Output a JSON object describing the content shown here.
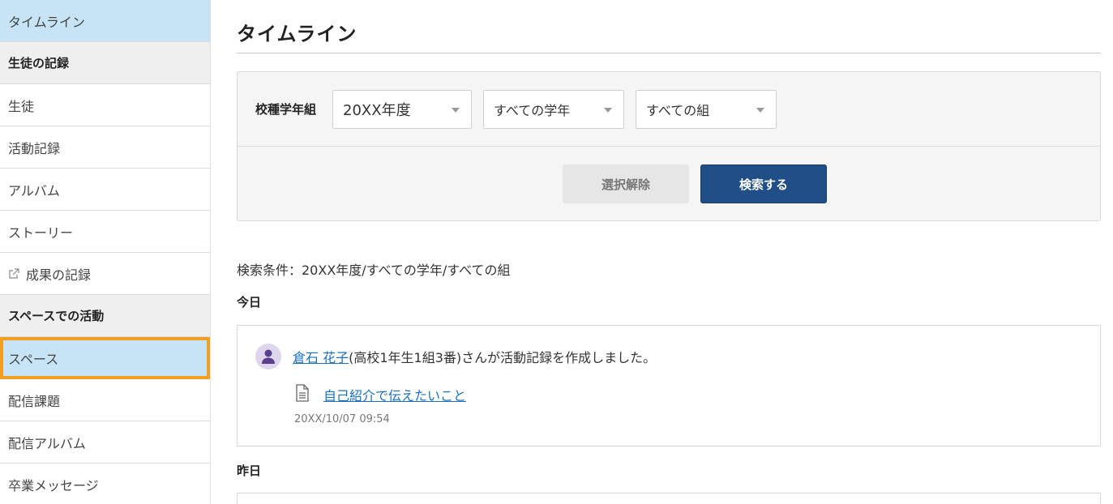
{
  "sidebar": {
    "items": [
      {
        "label": "タイムライン",
        "type": "active"
      },
      {
        "label": "生徒の記録",
        "type": "header"
      },
      {
        "label": "生徒",
        "type": "item"
      },
      {
        "label": "活動記録",
        "type": "item"
      },
      {
        "label": "アルバム",
        "type": "item"
      },
      {
        "label": "ストーリー",
        "type": "item"
      },
      {
        "label": "成果の記録",
        "type": "external",
        "icon": "external-link-icon"
      },
      {
        "label": "スペースでの活動",
        "type": "header"
      },
      {
        "label": "スペース",
        "type": "highlight"
      },
      {
        "label": "配信課題",
        "type": "item"
      },
      {
        "label": "配信アルバム",
        "type": "item"
      },
      {
        "label": "卒業メッセージ",
        "type": "item"
      }
    ]
  },
  "main": {
    "title": "タイムライン",
    "filter": {
      "label": "校種学年組",
      "year": "20XX年度",
      "grade": "すべての学年",
      "class": "すべての組"
    },
    "buttons": {
      "clear": "選択解除",
      "search": "検索する"
    },
    "conditions": "検索条件：20XX年度/すべての学年/すべての組",
    "today_label": "今日",
    "yesterday_label": "昨日",
    "entries": [
      {
        "user_name": "倉石 花子",
        "user_detail": "(高校1年生1組3番)さんが活動記録を作成しました。",
        "doc_title": "自己紹介で伝えたいこと",
        "timestamp": "20XX/10/07 09:54",
        "avatar_icon": "user-avatar-icon",
        "doc_icon": "document-icon"
      }
    ]
  },
  "colors": {
    "active_bg": "#c6e4f5",
    "highlight_border": "#f0a01e",
    "primary_button": "#1f4f86",
    "link": "#1a6fbf"
  }
}
